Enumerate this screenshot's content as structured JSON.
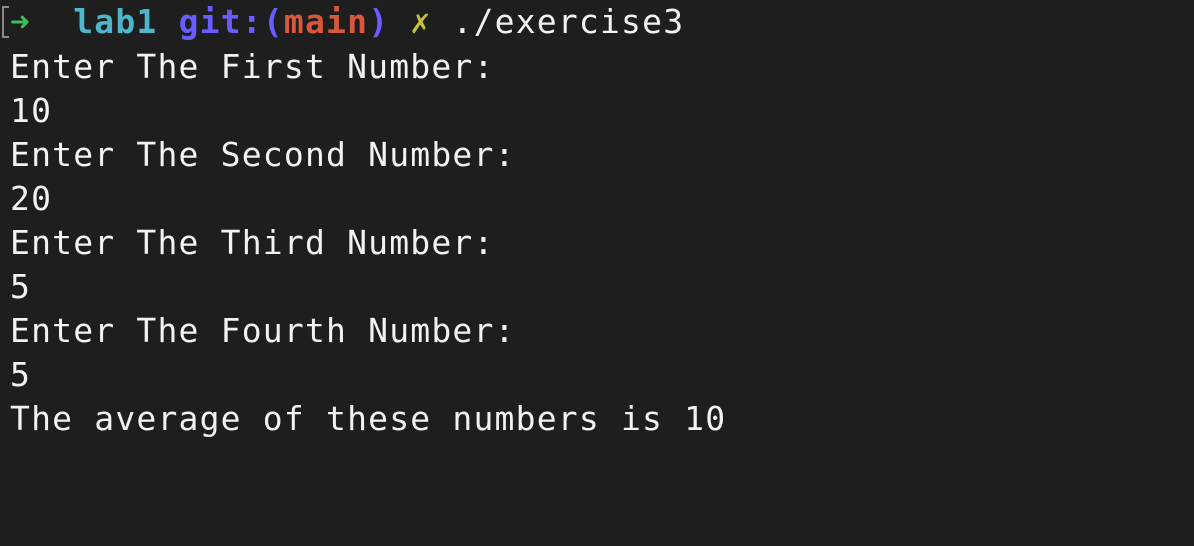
{
  "prompt": {
    "arrow": "➜",
    "directory": "lab1",
    "git_label": "git:(",
    "branch": "main",
    "git_close": ")",
    "dirty_marker": "✗",
    "command": "./exercise3"
  },
  "output_lines": [
    "Enter The First Number:",
    "10",
    "Enter The Second Number:",
    "20",
    "Enter The Third Number:",
    "5",
    "Enter The Fourth Number:",
    "5",
    "The average of these numbers is 10"
  ],
  "colors": {
    "background": "#1e1e1e",
    "text": "#f2f2f2",
    "arrow": "#39c05a",
    "directory": "#4fb5c9",
    "git": "#6a5cff",
    "branch": "#d9573b",
    "dirty": "#c4bf3c"
  }
}
